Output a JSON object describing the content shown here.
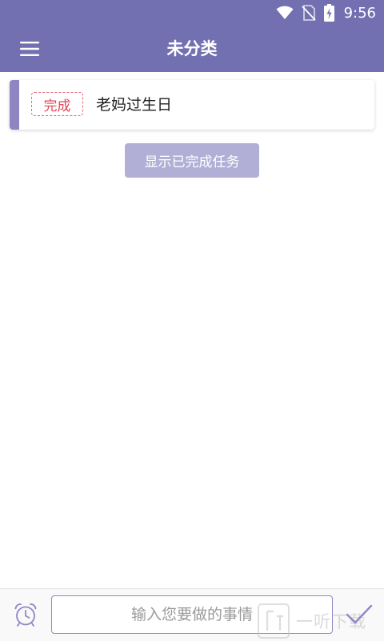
{
  "status_bar": {
    "time": "9:56",
    "icons": [
      "wifi-icon",
      "no-sim-icon",
      "battery-charging-icon"
    ]
  },
  "app_bar": {
    "title": "未分类",
    "menu_icon": "menu-icon"
  },
  "tasks": [
    {
      "status_button_label": "完成",
      "text": "老妈过生日",
      "accent_color": "#8e86c3"
    }
  ],
  "show_completed_button": {
    "label": "显示已完成任务"
  },
  "bottom_bar": {
    "alarm_icon": "alarm-clock-icon",
    "input": {
      "value": "",
      "placeholder": "输入您要做的事情"
    },
    "confirm_icon": "checkmark-icon"
  },
  "watermark": {
    "text": "一听下载"
  },
  "colors": {
    "primary": "#7370b1",
    "card_accent": "#8e86c3",
    "done_label": "#e0455a",
    "secondary_button": "#b1afd6"
  }
}
